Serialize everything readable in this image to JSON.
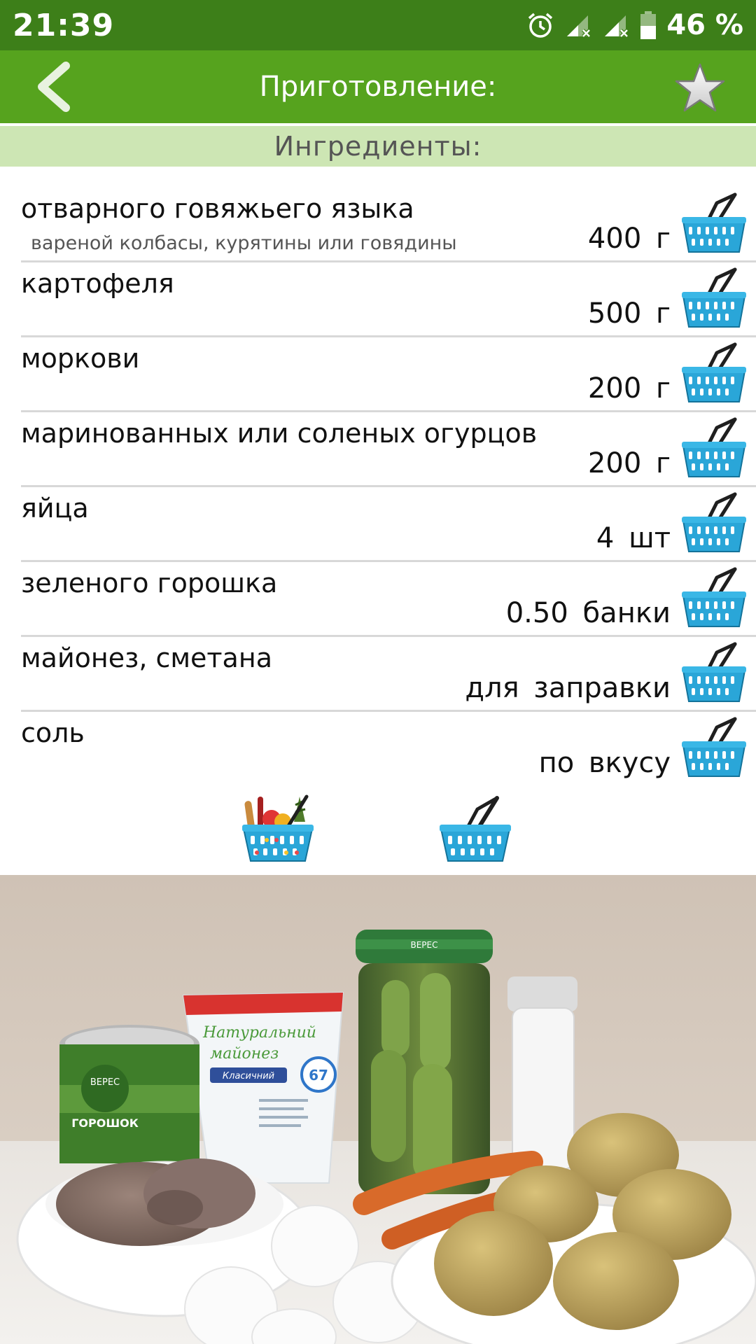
{
  "status_bar": {
    "time": "21:39",
    "battery": "46 %"
  },
  "header": {
    "title": "Приготовление:"
  },
  "section": {
    "title": "Ингредиенты:"
  },
  "ingredients": [
    {
      "name": "отварного говяжьего языка",
      "note": "вареной колбасы, курятины или говядины",
      "amount": "400 г"
    },
    {
      "name": "картофеля",
      "note": "",
      "amount": "500 г"
    },
    {
      "name": "моркови",
      "note": "",
      "amount": "200 г"
    },
    {
      "name": "маринованных или соленых огурцов",
      "note": "",
      "amount": "200 г"
    },
    {
      "name": "яйца",
      "note": "",
      "amount": "4 шт"
    },
    {
      "name": "зеленого горошка",
      "note": "",
      "amount": "0.50 банки"
    },
    {
      "name": "майонез, сметана",
      "note": "",
      "amount": "для заправки"
    },
    {
      "name": "соль",
      "note": "",
      "amount": "по вкусу"
    }
  ],
  "photo": {
    "mayo_label_1": "Натуральний",
    "mayo_label_2": "майонез",
    "mayo_label_3": "Класичний",
    "mayo_percent": "67",
    "jar_label": "ВЕРЕС",
    "can_label_1": "ВЕРЕС",
    "can_label_2": "ГОРОШОК"
  },
  "colors": {
    "status_bar": "#3d7f19",
    "app_bar": "#56a31e",
    "section_bar": "#cde6b4",
    "basket": "#1e9fd3"
  }
}
